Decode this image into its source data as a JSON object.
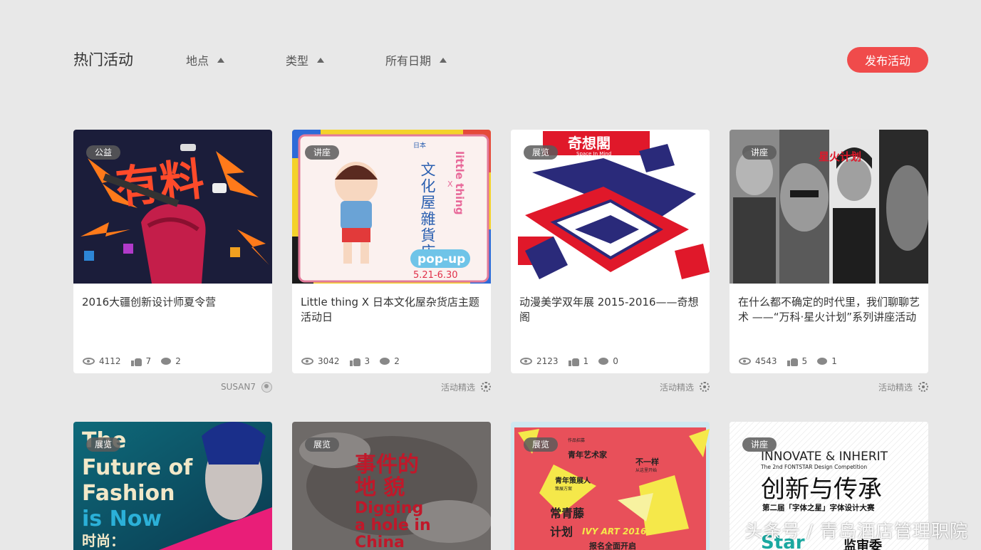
{
  "header": {
    "title": "热门活动",
    "filters": [
      "地点",
      "类型",
      "所有日期"
    ],
    "publish_label": "发布活动"
  },
  "cards": [
    {
      "badge": "公益",
      "title": "2016大疆创新设计师夏令营",
      "views": "4112",
      "likes": "7",
      "comments": "2",
      "footer": "SUSAN7",
      "poster_text": "有料"
    },
    {
      "badge": "讲座",
      "title": "Little thing X 日本文化屋杂货店主题活动日",
      "views": "3042",
      "likes": "3",
      "comments": "2",
      "footer": "活动精选",
      "poster_text": {
        "top": "日本",
        "v1": "文化屋雜貨店",
        "side": "little thing",
        "x": "X",
        "popup": "pop-up",
        "date": "5.21-6.30"
      }
    },
    {
      "badge": "展览",
      "title": "动漫美学双年展 2015-2016——奇想阁",
      "views": "2123",
      "likes": "1",
      "comments": "0",
      "footer": "活动精选",
      "poster_text": {
        "banner": "奇想閣",
        "sub": "Space In Mind"
      }
    },
    {
      "badge": "讲座",
      "title": "在什么都不确定的时代里，我们聊聊艺术 ——“万科·星火计划”系列讲座活动",
      "views": "4543",
      "likes": "5",
      "comments": "1",
      "footer": "活动精选",
      "poster_text": {
        "logo": "星火计划"
      }
    }
  ],
  "row2": [
    {
      "badge": "展览",
      "poster_text": {
        "l1": "The",
        "l2": "Future of",
        "l3": "Fashion",
        "l4": "is Now",
        "l5": "时尚："
      }
    },
    {
      "badge": "展览",
      "poster_text": {
        "l1": "事件的",
        "l2": "地  貌",
        "l3": "Digging",
        "l4": "a hole in",
        "l5": "China"
      }
    },
    {
      "badge": "展览",
      "poster_text": {
        "t1": "青年艺术家",
        "t2": "作品招募",
        "t3": "不一样",
        "t4": "从这里开始",
        "t5": "青年策展人",
        "t6": "策展方案",
        "t7": "常青藤",
        "t8": "计划",
        "t9": "IVY ART 2016",
        "t10": "报名全面开启"
      }
    },
    {
      "badge": "讲座",
      "poster_text": {
        "l1": "INNOVATE & INHERIT",
        "l2": "The 2nd FONTSTAR Design Competition",
        "l3": "创新与传承",
        "l4": "第二届「字体之星」字体设计大赛",
        "l5": "Star",
        "l6": "监审委"
      }
    }
  ],
  "watermark": "头条号 / 青岛酒店管理职院",
  "colors": {
    "accent": "#f04b4b",
    "background": "#e8e8e8"
  },
  "icons": [
    "eye-icon",
    "thumbs-up-icon",
    "comment-icon",
    "user-avatar-icon",
    "gear-icon",
    "caret-up-icon"
  ]
}
